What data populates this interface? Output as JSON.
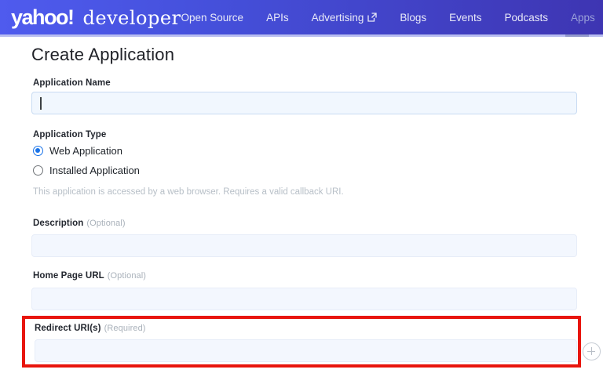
{
  "nav": {
    "logo": {
      "yahoo": "yahoo!",
      "developer": "developer"
    },
    "items": [
      {
        "label": "Open Source"
      },
      {
        "label": "APIs"
      },
      {
        "label": "Advertising",
        "external_link": true
      },
      {
        "label": "Blogs"
      },
      {
        "label": "Events"
      },
      {
        "label": "Podcasts"
      },
      {
        "label": "Apps",
        "active": true
      }
    ]
  },
  "page": {
    "title": "Create Application"
  },
  "form": {
    "application_name": {
      "label": "Application Name",
      "value": "",
      "focused": true
    },
    "application_type": {
      "label": "Application Type",
      "options": [
        {
          "label": "Web Application",
          "selected": true
        },
        {
          "label": "Installed Application",
          "selected": false
        }
      ],
      "help_text": "This application is accessed by a web browser. Requires a valid callback URI."
    },
    "description": {
      "label": "Description",
      "hint": "(Optional)",
      "value": ""
    },
    "home_page_url": {
      "label": "Home Page URL",
      "hint": "(Optional)",
      "value": ""
    },
    "redirect_uris": {
      "label": "Redirect URI(s)",
      "hint": "(Required)",
      "value": "",
      "add_icon": "plus-circle-icon"
    }
  },
  "annotation": {
    "shape": "red-highlight-rectangle",
    "color": "#e8150d",
    "target": "redirect_uris"
  },
  "colors": {
    "nav_gradient_start": "#4f5bee",
    "nav_gradient_end": "#3e35b2",
    "nav_bottom_border": "#b8bdf0",
    "radio_accent": "#1a73e8",
    "input_background": "#f3f7fe",
    "annotation_red": "#e8150d"
  }
}
